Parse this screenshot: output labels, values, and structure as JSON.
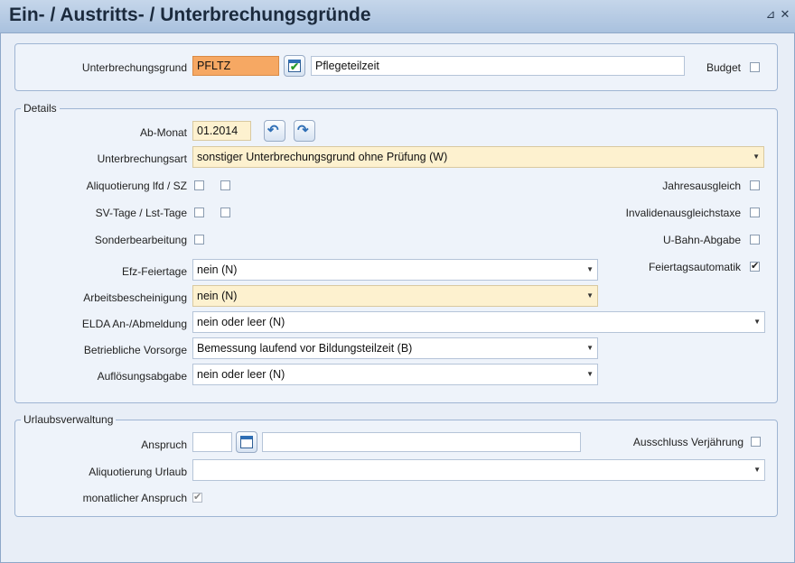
{
  "window": {
    "title": "Ein- / Austritts- / Unterbrechungsgründe",
    "pin_icon": "pin-icon",
    "close_icon": "close-icon",
    "pin_glyph": "⊿",
    "close_glyph": "✕"
  },
  "top": {
    "reason_label": "Unterbrechungsgrund",
    "reason_code": "PFLTZ",
    "reason_text": "Pflegeteilzeit",
    "budget_label": "Budget"
  },
  "details": {
    "legend": "Details",
    "ab_monat_label": "Ab-Monat",
    "ab_monat_value": "01.2014",
    "art_label": "Unterbrechungsart",
    "art_value": "sonstiger Unterbrechungsgrund ohne Prüfung (W)",
    "aliq_label": "Aliquotierung lfd / SZ",
    "svtage_label": "SV-Tage / Lst-Tage",
    "sonder_label": "Sonderbearbeitung",
    "jahres_label": "Jahresausgleich",
    "invaliden_label": "Invalidenausgleichstaxe",
    "ubahn_label": "U-Bahn-Abgabe",
    "efz_label": "Efz-Feiertage",
    "efz_value": "nein (N)",
    "feiertag_label": "Feiertagsautomatik",
    "feiertag_checked": "✔",
    "arbeits_label": "Arbeitsbescheinigung",
    "arbeits_value": "nein (N)",
    "elda_label": "ELDA An-/Abmeldung",
    "elda_value": "nein oder leer (N)",
    "betrieb_label": "Betriebliche Vorsorge",
    "betrieb_value": "Bemessung laufend vor Bildungsteilzeit (B)",
    "aufl_label": "Auflösungsabgabe",
    "aufl_value": "nein oder leer (N)"
  },
  "urlaub": {
    "legend": "Urlaubsverwaltung",
    "anspruch_label": "Anspruch",
    "anspruch_value": "",
    "anspruch_text": "",
    "ausschluss_label": "Ausschluss Verjährung",
    "aliq_label": "Aliquotierung Urlaub",
    "aliq_value": "",
    "monatlich_label": "monatlicher Anspruch",
    "monatlich_checked": "✔"
  },
  "glyphs": {
    "dropdown_arrow": "▼",
    "back_arrow": "↶",
    "forward_arrow": "↷",
    "check": "✔"
  }
}
